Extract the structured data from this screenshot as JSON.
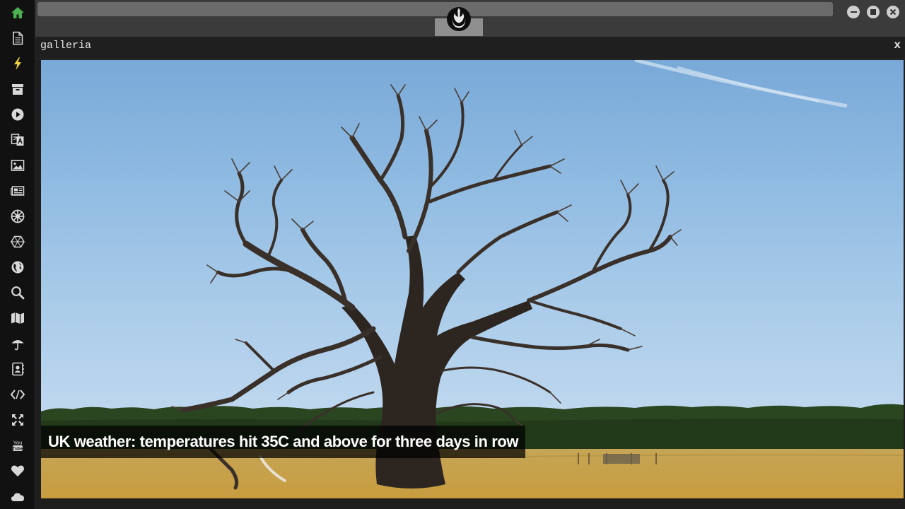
{
  "sidebar": {
    "items": [
      {
        "icon": "home-icon",
        "active": true
      },
      {
        "icon": "document-icon"
      },
      {
        "icon": "lightning-icon"
      },
      {
        "icon": "archive-icon"
      },
      {
        "icon": "play-icon"
      },
      {
        "icon": "translate-icon"
      },
      {
        "icon": "image-icon"
      },
      {
        "icon": "newspaper-icon"
      },
      {
        "icon": "galactic-empire-icon"
      },
      {
        "icon": "hexagon-icon"
      },
      {
        "icon": "globe-icon"
      },
      {
        "icon": "search-icon"
      },
      {
        "icon": "map-icon"
      },
      {
        "icon": "umbrella-icon"
      },
      {
        "icon": "contact-book-icon"
      },
      {
        "icon": "code-icon"
      },
      {
        "icon": "expand-icon"
      },
      {
        "icon": "youtube-icon"
      },
      {
        "icon": "heart-icon"
      },
      {
        "icon": "cloud-icon"
      }
    ],
    "active_color": "#4caf50",
    "icon_color": "#d8d8d8"
  },
  "topbar": {
    "logo_icon": "rebel-alliance-icon",
    "window_controls": [
      "minimize-icon",
      "maximize-icon",
      "close-icon"
    ]
  },
  "panel": {
    "title": "galleria",
    "close_label": "x"
  },
  "gallery": {
    "caption": "UK weather: temperatures hit 35C and above for three days in row"
  }
}
